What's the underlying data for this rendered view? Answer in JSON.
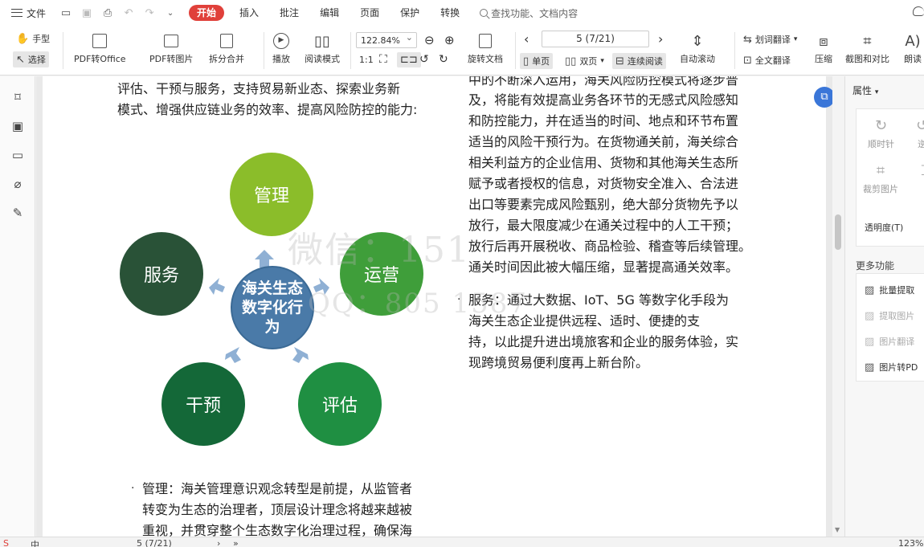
{
  "menu": {
    "file_label": "文件",
    "tabs": [
      "开始",
      "插入",
      "批注",
      "编辑",
      "页面",
      "保护",
      "转换"
    ],
    "search_placeholder": "查找功能、文档内容"
  },
  "ribbon": {
    "hand": "手型",
    "select": "选择",
    "pdf_to_office": "PDF转Office",
    "pdf_to_image": "PDF转图片",
    "split_merge": "拆分合并",
    "play": "播放",
    "read_mode": "阅读模式",
    "zoom": "122.84%",
    "rotate_doc": "旋转文档",
    "page_indicator": "5 (7/21)",
    "single_page": "单页",
    "double_page": "双页",
    "continuous": "连续阅读",
    "auto_scroll": "自动滚动",
    "word_translate": "划词翻译",
    "full_translate": "全文翻译",
    "compress": "压缩",
    "screenshot_compare": "截图和对比",
    "read_aloud": "朗读"
  },
  "document": {
    "left_top_lines": [
      "评估、干预与服务，支持贸易新业态、探索业务新",
      "模式、增强供应链业务的效率、提高风险防控的能力:"
    ],
    "diagram": {
      "center": "海关生态数字化行为",
      "nodes": {
        "top": "管理",
        "right": "运营",
        "bottom_right": "评估",
        "bottom_left": "干预",
        "left": "服务"
      }
    },
    "left_bottom_lines": [
      "管理：海关管理意识观念转型是前提，从监管者",
      "转变为生态的治理者，顶层设计理念将越来越被",
      "重视，并贯穿整个生态数字化治理过程，确保海"
    ],
    "right_lines": [
      "中的不断深入运用，海关风险防控模式将逐步普",
      "及，将能有效提高业务各环节的无感式风险感知",
      "和防控能力，并在适当的时间、地点和环节布置",
      "适当的风险干预行为。在货物通关前，海关综合",
      "相关利益方的企业信用、货物和其他海关生态所",
      "赋予或者授权的信息，对货物安全准入、合法进",
      "出口等要素完成风险甄别，绝大部分货物先予以",
      "放行，最大限度减少在通关过程中的人工干预；",
      "放行后再开展税收、商品检验、稽查等后续管理。",
      "通关时间因此被大幅压缩，显著提高通关效率。"
    ],
    "right_bullet_lines": [
      "服务：通过大数据、IoT、5G 等数字化手段为",
      "海关生态企业提供远程、适时、便捷的支",
      "持，以此提升进出境旅客和企业的服务体验，实",
      "现跨境贸易便利度再上新台阶。"
    ],
    "watermark_line1": "微信：151",
    "watermark_line2": "QQ：805 1587"
  },
  "right_panel": {
    "header": "属性",
    "clockwise": "顺时针",
    "counter": "逆",
    "crop": "裁剪图片",
    "opacity": "透明度(T)",
    "more": "更多功能",
    "batch_extract": "批量提取",
    "extract_image": "提取图片",
    "image_translate": "图片翻译",
    "image_to_pdf": "图片转PD"
  },
  "status": {
    "page": "5 (7/21)",
    "zoom": "123%"
  }
}
